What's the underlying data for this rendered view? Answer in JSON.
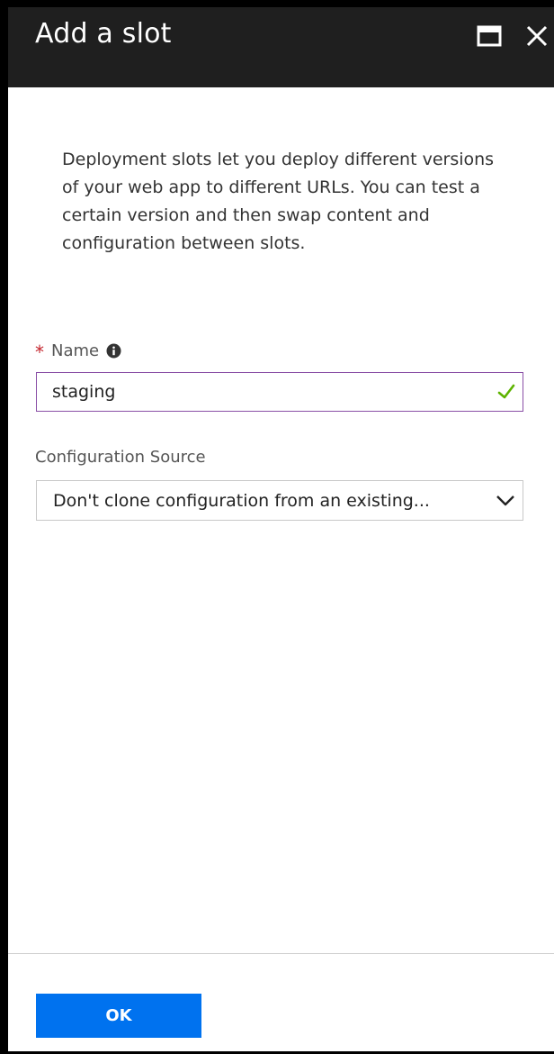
{
  "blade": {
    "title": "Add a slot",
    "maximize_icon": "maximize-icon",
    "close_icon": "close-icon"
  },
  "description": "Deployment slots let you deploy different versions of your web app to different URLs. You can test a certain version and then swap content and configuration between slots.",
  "name_field": {
    "required_marker": "*",
    "label": "Name",
    "info_icon": "info-icon",
    "value": "staging",
    "valid_icon": "checkmark-icon",
    "valid": true
  },
  "config_source": {
    "label": "Configuration Source",
    "selected": "Don't clone configuration from an existing...",
    "dropdown_icon": "chevron-down-icon"
  },
  "footer": {
    "ok_label": "OK"
  },
  "colors": {
    "header_bg": "#1f1f1f",
    "accent": "#0072ef",
    "focus_border": "#8a4fa6",
    "success": "#5db300",
    "required": "#c4262e"
  }
}
